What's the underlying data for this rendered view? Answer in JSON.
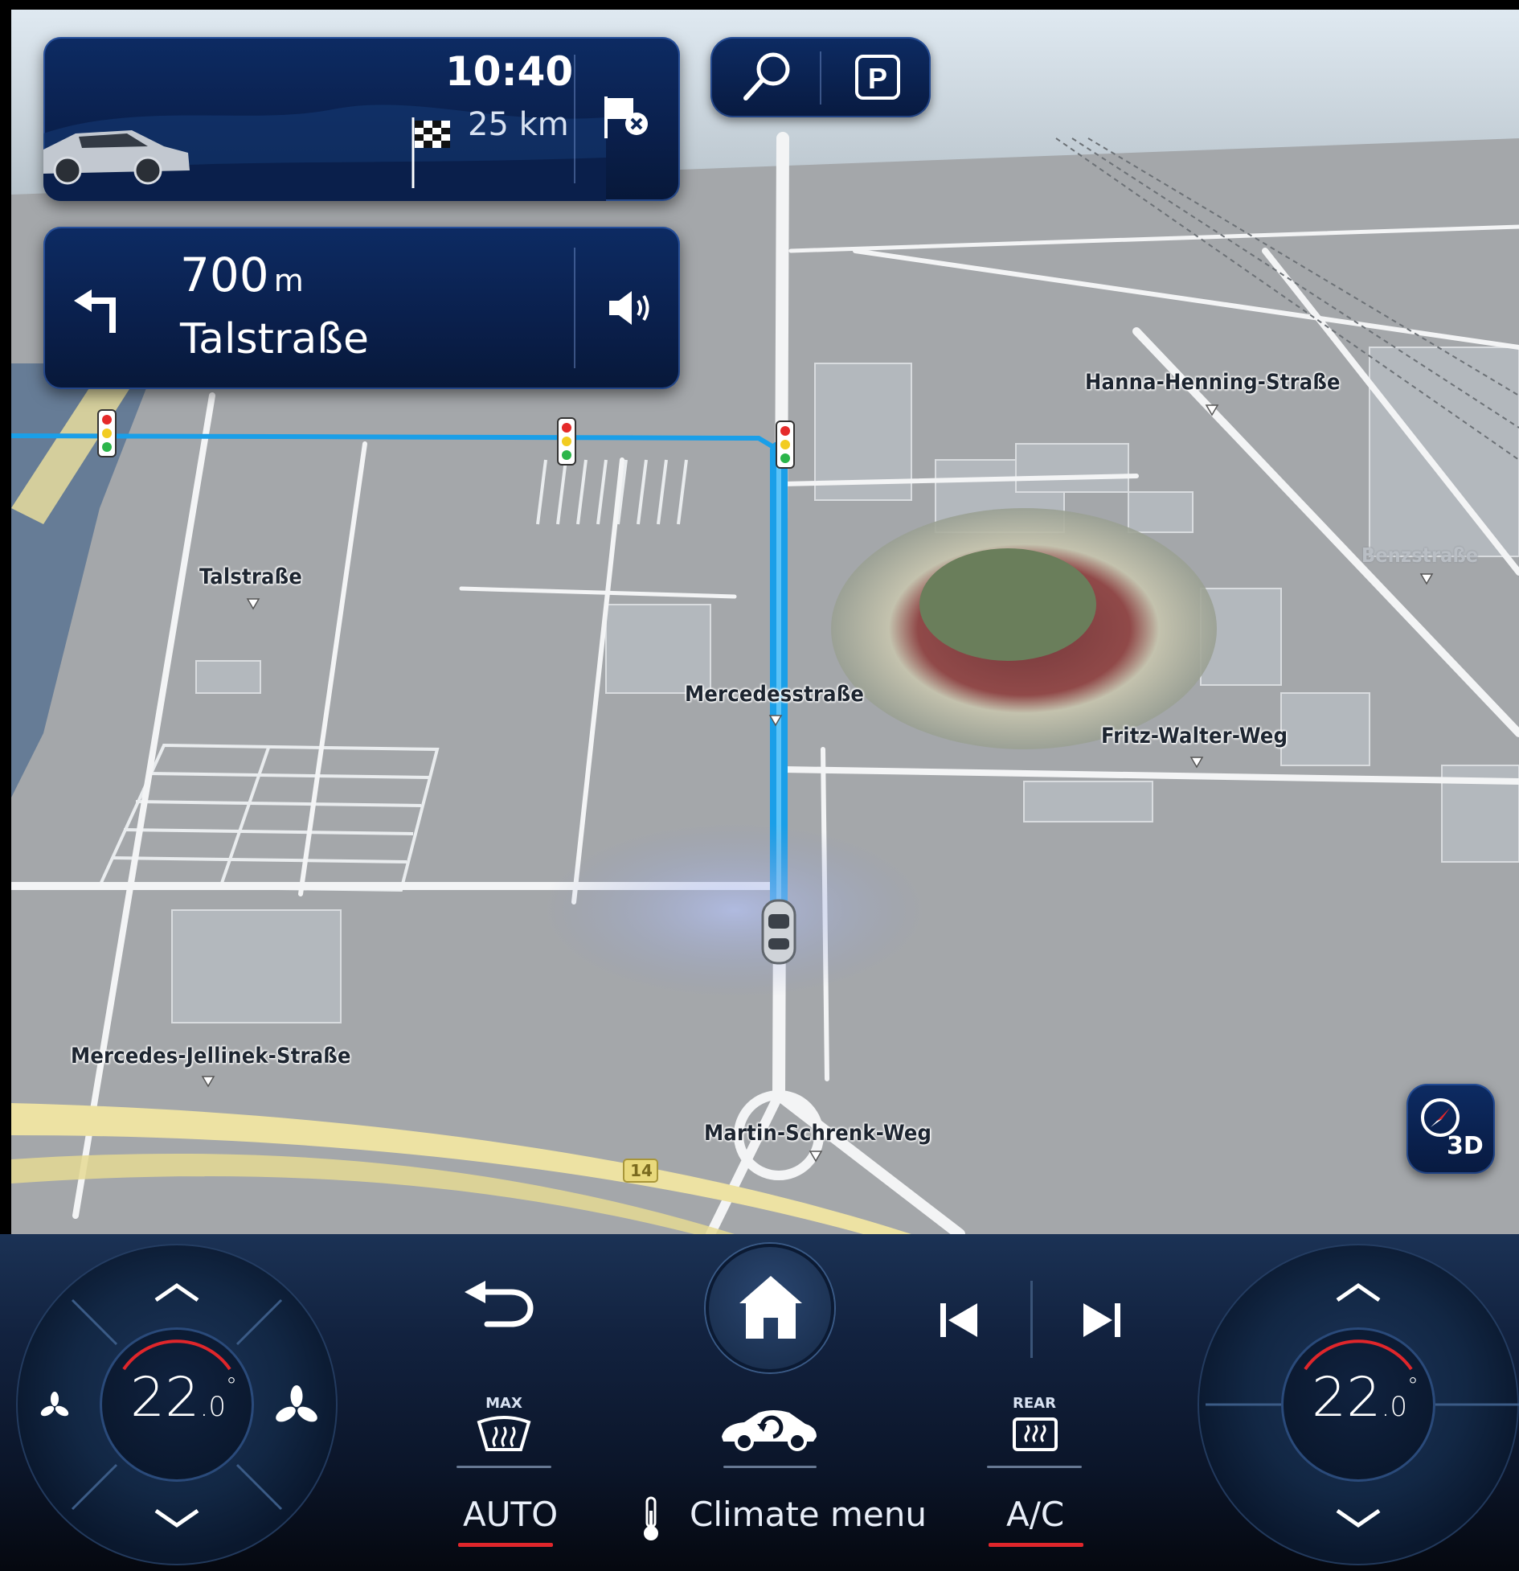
{
  "route_panel": {
    "arrival_time": "10:40",
    "distance_remaining": "25 km"
  },
  "maneuver_panel": {
    "distance_value": "700",
    "distance_unit": "m",
    "street": "Talstraße"
  },
  "map": {
    "labels": {
      "hanna_henning": "Hanna-Henning-Straße",
      "benzstrasse": "Benzstraße",
      "talstrasse": "Talstraße",
      "mercedesstrasse": "Mercedesstraße",
      "fritz_walter": "Fritz-Walter-Weg",
      "mercedes_jellinek": "Mercedes-Jellinek-Straße",
      "martin_schrenk": "Martin-Schrenk-Weg",
      "road_shield": "14"
    },
    "view_mode_button": "3D"
  },
  "climate": {
    "left_temp_main": "22",
    "left_temp_decimal": ".0",
    "right_temp_main": "22",
    "right_temp_decimal": ".0",
    "degree": "°",
    "max_defrost_label": "MAX",
    "rear_defrost_label": "REAR",
    "auto_label": "AUTO",
    "climate_menu_label": "Climate menu",
    "ac_label": "A/C"
  },
  "colors": {
    "route_blue": "#1a9fe8",
    "panel_blue": "#0b2556",
    "active_red": "#e0262b"
  }
}
